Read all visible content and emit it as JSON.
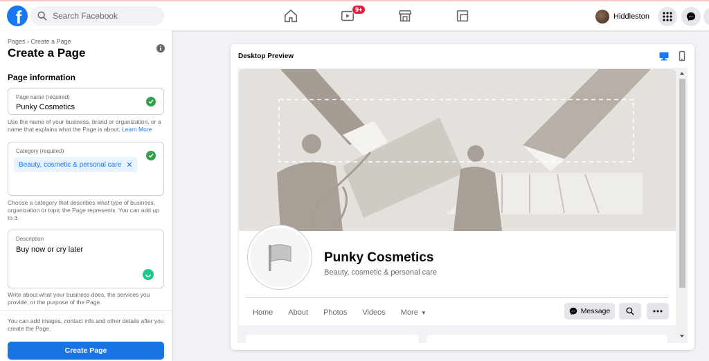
{
  "topbar": {
    "search_placeholder": "Search Facebook",
    "notification_badge": "9+",
    "profile_name": "Hiddleston"
  },
  "sidebar": {
    "breadcrumb": "Pages › Create a Page",
    "title": "Create a Page",
    "section_title": "Page information",
    "page_name": {
      "label": "Page name (required)",
      "value": "Punky Cosmetics",
      "helper": "Use the name of your business, brand or organization, or a name that explains what the Page is about.",
      "learn_more": "Learn More"
    },
    "category": {
      "label": "Category (required)",
      "chip": "Beauty, cosmetic & personal care",
      "helper": "Choose a category that describes what type of business, organization or topic the Page represents. You can add up to 3."
    },
    "description": {
      "label": "Description",
      "value": "Buy now or cry later",
      "helper": "Write about what your business does, the services you provide, or the purpose of the Page."
    },
    "footer_note": "You can add images, contact info and other details after you create the Page.",
    "create_button": "Create Page"
  },
  "preview": {
    "title": "Desktop Preview",
    "page_name": "Punky Cosmetics",
    "page_category": "Beauty, cosmetic & personal care",
    "tabs": [
      "Home",
      "About",
      "Photos",
      "Videos",
      "More"
    ],
    "message_button": "Message"
  },
  "colors": {
    "brand_blue": "#1877f2",
    "success_green": "#31a24c",
    "badge_red": "#e41e3f"
  }
}
